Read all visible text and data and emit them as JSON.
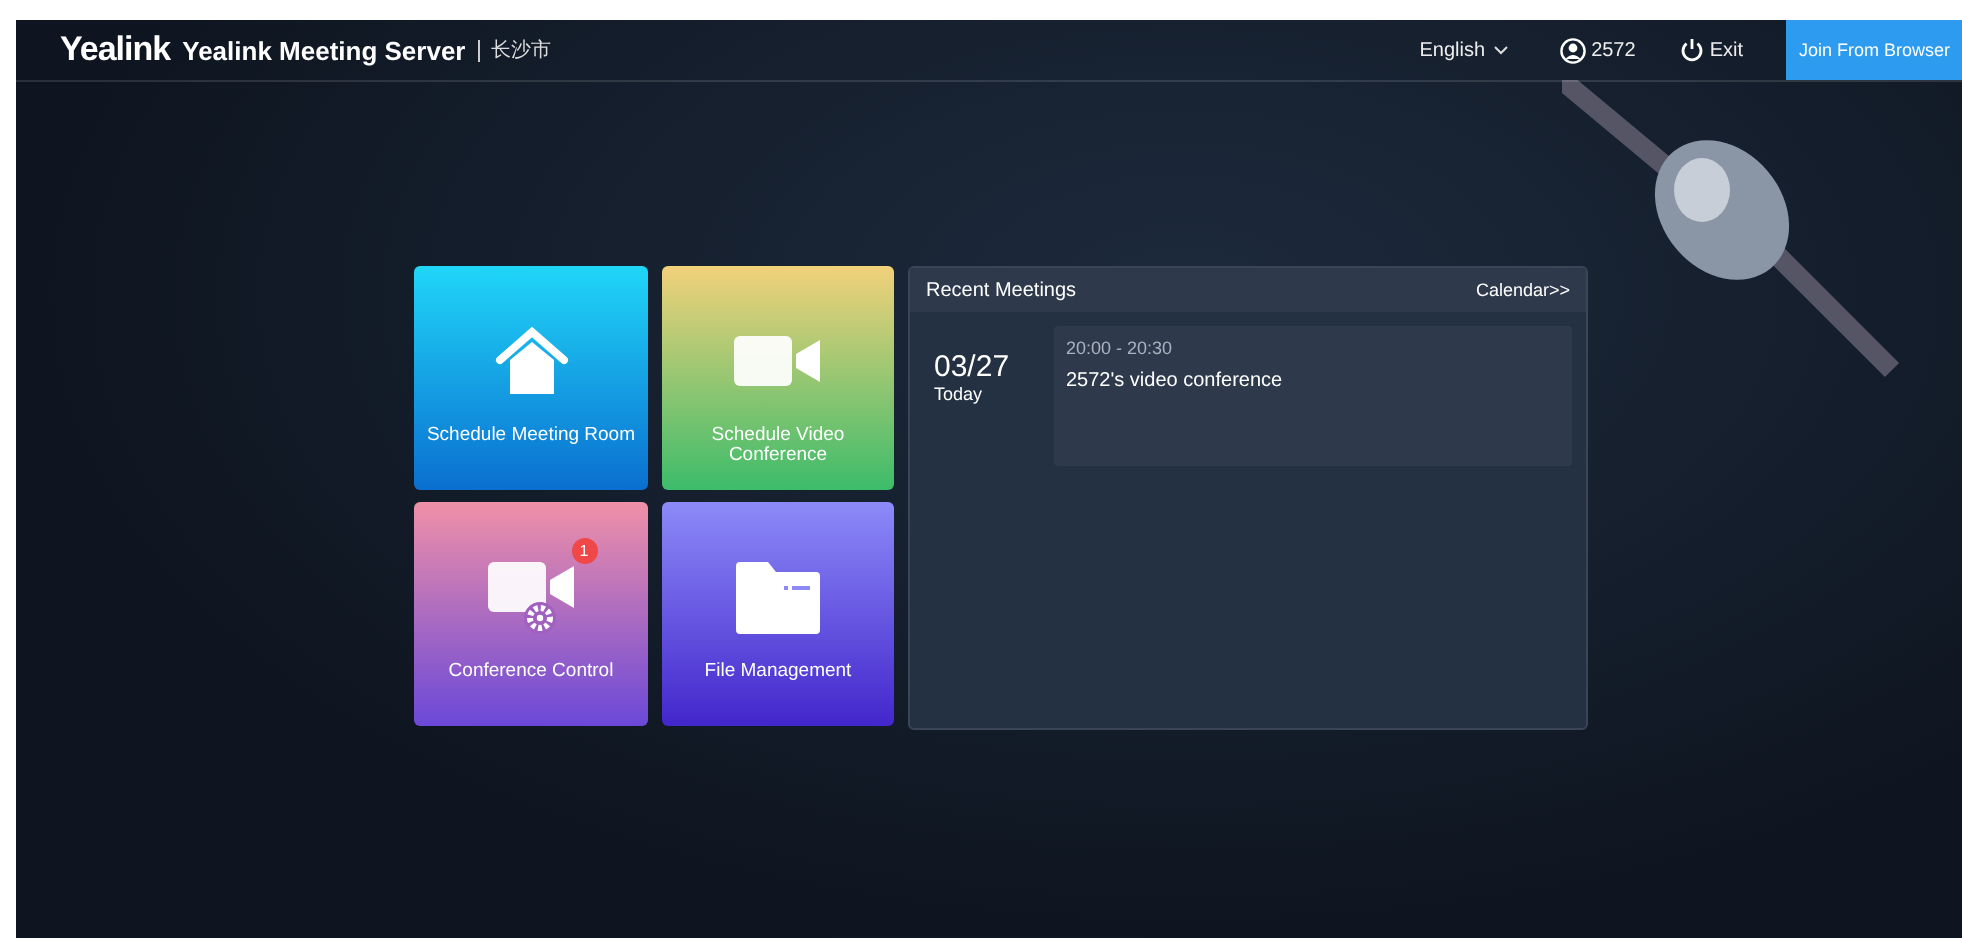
{
  "header": {
    "logo": "Yealink",
    "title": "Yealink Meeting Server",
    "city": "长沙市",
    "language": "English",
    "user": "2572",
    "exit": "Exit",
    "join_button": "Join From Browser"
  },
  "tiles": [
    {
      "kind": "room",
      "label": "Schedule Meeting Room"
    },
    {
      "kind": "video",
      "label": "Schedule Video Conference"
    },
    {
      "kind": "control",
      "label": "Conference Control",
      "badge": "1"
    },
    {
      "kind": "files",
      "label": "File Management"
    }
  ],
  "recent_meetings": {
    "title": "Recent Meetings",
    "calendar_link": "Calendar>>",
    "meetings": [
      {
        "date": "03/27",
        "day": "Today",
        "time": "20:00 - 20:30",
        "name": "2572's video conference"
      }
    ]
  }
}
